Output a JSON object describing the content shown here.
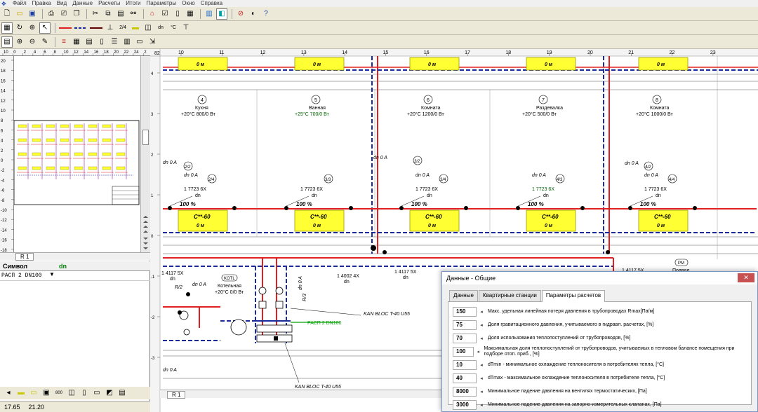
{
  "menu": [
    "Файл",
    "Правка",
    "Вид",
    "Данные",
    "Расчеты",
    "Итоги",
    "Параметры",
    "Окно",
    "Справка"
  ],
  "toolbar1": [
    "new-icon",
    "open-icon",
    "save-icon",
    "print-icon",
    "preview-icon",
    "copy-doc-icon",
    "cut-icon",
    "copy-icon",
    "paste-icon",
    "find-icon",
    "binoculars-icon",
    "house-icon",
    "doc-check-icon",
    "doc-icon",
    "calc-icon",
    "building-icon",
    "mirror-icon",
    "stop-icon",
    "info-icon",
    "help-icon"
  ],
  "toolbar2_labels": {
    "dn": "dn"
  },
  "left": {
    "ruler_h_ticks": [
      "10",
      "0",
      "2",
      "4",
      "6",
      "8",
      "10",
      "12",
      "14",
      "16",
      "18",
      "20",
      "22",
      "24",
      "2"
    ],
    "ruler_v_ticks": [
      "20",
      "18",
      "16",
      "14",
      "12",
      "10",
      "8",
      "6",
      "4",
      "2",
      "0",
      "-2",
      "-4",
      "-6",
      "-8",
      "-10",
      "-12",
      "-14",
      "-16",
      "-18"
    ],
    "sheet_tab": "R 1",
    "props_header": [
      "Символ",
      "dn"
    ],
    "props_row": [
      "РАСП 2 DN100",
      ""
    ],
    "status_x": "17.65",
    "status_y": "21.20"
  },
  "drawing": {
    "ruler_h_ticks": [
      "10",
      "11",
      "12",
      "13",
      "14",
      "15",
      "16",
      "17",
      "18",
      "19",
      "20",
      "21",
      "22",
      "23"
    ],
    "ruler_v_ticks": [
      "4",
      "3",
      "2",
      "1",
      "0",
      "-1",
      "-2",
      "-3"
    ],
    "corner": "82",
    "sheet_tab": "R 1",
    "top_radiators": [
      "0 м",
      "0 м",
      "0 м",
      "0 м",
      "0 м"
    ],
    "rooms": [
      {
        "num": "4",
        "name": "Кухня",
        "temp": "+20°C 800/0 Вт"
      },
      {
        "num": "5",
        "name": "Ванная",
        "temp": "+25°C 700/0 Вт"
      },
      {
        "num": "6",
        "name": "Комната",
        "temp": "+20°C 1200/0 Вт"
      },
      {
        "num": "7",
        "name": "Раздевалка",
        "temp": "+20°C 500/0 Вт"
      },
      {
        "num": "8",
        "name": "Комната",
        "temp": "+20°C 1000/0 Вт"
      }
    ],
    "radiators": [
      {
        "type": "С**-60",
        "len": "0 м",
        "pct": "100 %",
        "pipe": "1 7723 6X",
        "dn": "dn",
        "dn0": "dn 0 A",
        "tag": "2/4"
      },
      {
        "type": "С**-60",
        "len": "0 м",
        "pct": "100 %",
        "pipe": "1 7723 6X",
        "dn": "dn",
        "dn0": "",
        "tag": "3/3"
      },
      {
        "type": "С**-60",
        "len": "0 м",
        "pct": "100 %",
        "pipe": "1 7723 6X",
        "dn": "dn",
        "dn0": "dn 0 A",
        "tag": "3/4"
      },
      {
        "type": "С**-60",
        "len": "0 м",
        "pct": "100 %",
        "pipe": "1 7723 6X",
        "dn": "dn",
        "dn0": "dn 0 A",
        "tag": "4/3"
      },
      {
        "type": "С**-60",
        "len": "0 м",
        "pct": "100 %",
        "pipe": "1 7723 6X",
        "dn": "dn",
        "dn0": "dn 0 A",
        "tag": "4/4"
      }
    ],
    "extra_labels": {
      "dn0a_1": "dn 0 A",
      "tag_2_2": "2/2",
      "dn0a_3": "dn 0 A",
      "tag_3_2": "3/2",
      "dn0a_4": "dn 0 A",
      "tag_4_2": "4/2",
      "pipe_left": "1 4117 5X",
      "dn_left": "dn",
      "pipe_mid1": "1 4002 4X",
      "dn_mid1": "dn",
      "pipe_mid2": "1 4117 5X",
      "dn_mid2": "dn",
      "pipe_right": "1 4117 5X",
      "dn0a_boiler": "dn 0 A",
      "r2": "R/2",
      "kotl": "KOTL",
      "boiler_name": "Котельная",
      "boiler_temp": "+20°C 0/0 Вт",
      "dn0a_vert": "dn 0 A",
      "r3": "R/3",
      "kan1": "KAN BLOC T-40 U55",
      "kan2": "KAN BLOC T-40 U55",
      "rasp": "РАСП 2 DN100",
      "pm": "PM",
      "podval": "Подвал",
      "dn0a_bottom": "dn 0 A"
    }
  },
  "dialog": {
    "title": "Данные - Общие",
    "close": "✕",
    "tabs": [
      "Данные",
      "Квартирные станции",
      "Параметры расчетов"
    ],
    "params": [
      {
        "value": "150",
        "label": "Макс. удельная линейная потеря давления в трубопроводах Rmax[Па/м]"
      },
      {
        "value": "75",
        "label": "Доля гравитационного давления, учитываемого в гидравл. расчетах, [%]"
      },
      {
        "value": "70",
        "label": "Доля использования теплопоступлений от трубопроводов, [%]"
      },
      {
        "value": "100",
        "label": "Максимальная доля теплопоступлений от трубопроводов, учитываемых в тепловом балансе помещения при подборе отоп. приб., [%]"
      },
      {
        "value": "10",
        "label": "dTmin - минимальное охлаждение теплоносителя в потребителях тепла, [°С]"
      },
      {
        "value": "40",
        "label": "dTmax - максимальное охлаждение теплоносителя в потребителе тепла, [°С]"
      },
      {
        "value": "8000",
        "label": "Минимальное падение давления на вентилях термостатических, [Па]"
      },
      {
        "value": "3000",
        "label": "Минимальное падение давления на запорно-измерительных клапанах, [Па]"
      }
    ]
  },
  "colors": {
    "pipe_supply": "#e02020",
    "pipe_return": "#1a2a9a",
    "radiator": "#ffff33",
    "radiator_border": "#999900",
    "purple": "#a020a0",
    "green": "#00a000"
  }
}
